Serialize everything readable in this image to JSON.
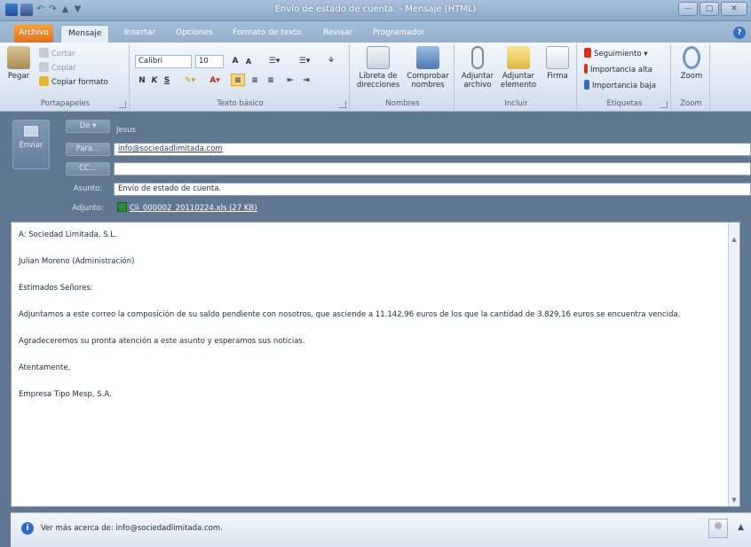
{
  "window": {
    "title": "Envío de estado de cuenta. - Mensaje (HTML)"
  },
  "tabs": [
    "Archivo",
    "Mensaje",
    "Insertar",
    "Opciones",
    "Formato de texto",
    "Revisar",
    "Programador"
  ],
  "ribbon": {
    "clipboard": {
      "paste": "Pegar",
      "cut": "Cortar",
      "copy": "Copiar",
      "format_painter": "Copiar formato",
      "label": "Portapapeles"
    },
    "basic_text": {
      "font": "Calibri",
      "size": "10",
      "bold": "N",
      "italic": "K",
      "underline": "S",
      "label": "Texto básico"
    },
    "names": {
      "address_book": "Libreta de direcciones",
      "check_names": "Comprobar nombres",
      "label": "Nombres"
    },
    "include": {
      "attach_file": "Adjuntar archivo",
      "attach_item": "Adjuntar elemento",
      "signature": "Firma",
      "label": "Incluir"
    },
    "tags": {
      "follow_up": "Seguimiento",
      "high_importance": "Importancia alta",
      "low_importance": "Importancia baja",
      "label": "Etiquetas"
    },
    "zoom": {
      "zoom": "Zoom",
      "label": "Zoom"
    }
  },
  "header": {
    "send": "Enviar",
    "from_button": "De",
    "from_value": "Jesus",
    "to_button": "Para...",
    "to_value": "info@sociedadlimitada.com",
    "cc_button": "CC...",
    "cc_value": "",
    "subject_label": "Asunto:",
    "subject_value": "Envío de estado de cuenta.",
    "attachment_label": "Adjunto:",
    "attachment_value": "Cli_000002_20110224.xls (27 KB)"
  },
  "body": {
    "line1": "A: Sociedad Limitada, S.L.",
    "line2": "Julian Moreno (Administración)",
    "line3": "Estimados Señores:",
    "line4": "Adjuntamos a este correo la composición de su saldo pendiente con nosotros, que asciende a 11.142,96 euros de los que la cantidad de 3.829,16 euros se encuentra vencida.",
    "line5": "Agradeceremos su pronta atención a este asunto y esperamos sus noticias.",
    "line6": "Atentamente,",
    "line7": "Empresa Tipo Mesp, S.A."
  },
  "people_pane": {
    "text": "Ver más acerca de: info@sociedadlimitada.com."
  },
  "colors": {
    "file_tab": "#e0701a",
    "frame": "#5f7790",
    "link": "#1c3f8a"
  }
}
